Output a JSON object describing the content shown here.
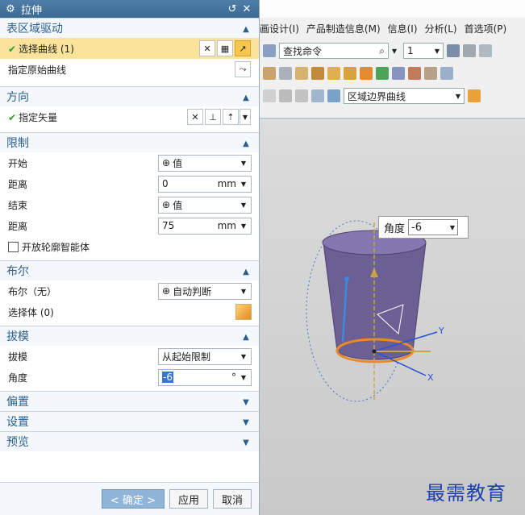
{
  "dialog": {
    "title": "拉伸",
    "buttons": {
      "reset_icon": "↺",
      "close_icon": "✕"
    },
    "groups": {
      "section": {
        "title": "表区域驱动",
        "select_curve": "选择曲线 (1)",
        "specify_origin_curve": "指定原始曲线"
      },
      "direction": {
        "title": "方向",
        "specify_vector": "指定矢量"
      },
      "limits": {
        "title": "限制",
        "start_label": "开始",
        "start_value": "值",
        "start_distance_label": "距离",
        "start_distance_value": "0",
        "start_distance_unit": "mm",
        "end_label": "结束",
        "end_value": "值",
        "end_distance_label": "距离",
        "end_distance_value": "75",
        "end_distance_unit": "mm",
        "open_profile_label": "开放轮廓智能体"
      },
      "boolean": {
        "title": "布尔",
        "boolean_label": "布尔（无）",
        "boolean_value": "自动判断",
        "select_body": "选择体 (0)"
      },
      "draft": {
        "title": "拔模",
        "draft_label": "拔模",
        "draft_value": "从起始限制",
        "angle_label": "角度",
        "angle_value": "-6",
        "angle_unit": "°"
      },
      "offset": {
        "title": "偏置"
      },
      "settings": {
        "title": "设置"
      },
      "preview": {
        "title": "预览"
      }
    },
    "footer": {
      "ok": "< 确定 >",
      "apply": "应用",
      "cancel": "取消"
    }
  },
  "app": {
    "menu": [
      "画设计(I)",
      "产品制造信息(M)",
      "信息(I)",
      "分析(L)",
      "首选项(P)"
    ],
    "command_search_placeholder": "查找命令",
    "layer_value": "1",
    "selection_filter": "区域边界曲线",
    "angle_popup": {
      "label": "角度",
      "value": "-6"
    },
    "axes": {
      "x": "X",
      "y": "Y"
    }
  },
  "watermark": "最需教育",
  "colors": {
    "title_bar": "#3b6a94",
    "group_title": "#2a5f8f",
    "highlight_row": "#fbe39c",
    "body_fill": "#6b5f94",
    "edge_orange": "#e8892b",
    "watermark": "#1b3fb0"
  }
}
